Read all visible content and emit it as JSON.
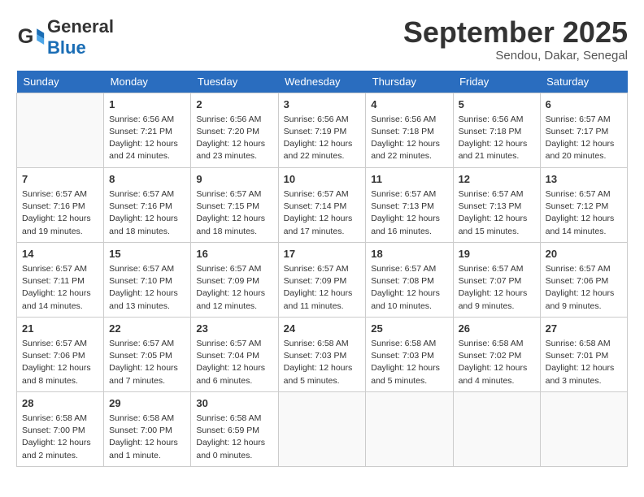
{
  "logo": {
    "general": "General",
    "blue": "Blue"
  },
  "title": "September 2025",
  "location": "Sendou, Dakar, Senegal",
  "weekdays": [
    "Sunday",
    "Monday",
    "Tuesday",
    "Wednesday",
    "Thursday",
    "Friday",
    "Saturday"
  ],
  "weeks": [
    [
      {
        "day": "",
        "info": ""
      },
      {
        "day": "1",
        "info": "Sunrise: 6:56 AM\nSunset: 7:21 PM\nDaylight: 12 hours\nand 24 minutes."
      },
      {
        "day": "2",
        "info": "Sunrise: 6:56 AM\nSunset: 7:20 PM\nDaylight: 12 hours\nand 23 minutes."
      },
      {
        "day": "3",
        "info": "Sunrise: 6:56 AM\nSunset: 7:19 PM\nDaylight: 12 hours\nand 22 minutes."
      },
      {
        "day": "4",
        "info": "Sunrise: 6:56 AM\nSunset: 7:18 PM\nDaylight: 12 hours\nand 22 minutes."
      },
      {
        "day": "5",
        "info": "Sunrise: 6:56 AM\nSunset: 7:18 PM\nDaylight: 12 hours\nand 21 minutes."
      },
      {
        "day": "6",
        "info": "Sunrise: 6:57 AM\nSunset: 7:17 PM\nDaylight: 12 hours\nand 20 minutes."
      }
    ],
    [
      {
        "day": "7",
        "info": "Sunrise: 6:57 AM\nSunset: 7:16 PM\nDaylight: 12 hours\nand 19 minutes."
      },
      {
        "day": "8",
        "info": "Sunrise: 6:57 AM\nSunset: 7:16 PM\nDaylight: 12 hours\nand 18 minutes."
      },
      {
        "day": "9",
        "info": "Sunrise: 6:57 AM\nSunset: 7:15 PM\nDaylight: 12 hours\nand 18 minutes."
      },
      {
        "day": "10",
        "info": "Sunrise: 6:57 AM\nSunset: 7:14 PM\nDaylight: 12 hours\nand 17 minutes."
      },
      {
        "day": "11",
        "info": "Sunrise: 6:57 AM\nSunset: 7:13 PM\nDaylight: 12 hours\nand 16 minutes."
      },
      {
        "day": "12",
        "info": "Sunrise: 6:57 AM\nSunset: 7:13 PM\nDaylight: 12 hours\nand 15 minutes."
      },
      {
        "day": "13",
        "info": "Sunrise: 6:57 AM\nSunset: 7:12 PM\nDaylight: 12 hours\nand 14 minutes."
      }
    ],
    [
      {
        "day": "14",
        "info": "Sunrise: 6:57 AM\nSunset: 7:11 PM\nDaylight: 12 hours\nand 14 minutes."
      },
      {
        "day": "15",
        "info": "Sunrise: 6:57 AM\nSunset: 7:10 PM\nDaylight: 12 hours\nand 13 minutes."
      },
      {
        "day": "16",
        "info": "Sunrise: 6:57 AM\nSunset: 7:09 PM\nDaylight: 12 hours\nand 12 minutes."
      },
      {
        "day": "17",
        "info": "Sunrise: 6:57 AM\nSunset: 7:09 PM\nDaylight: 12 hours\nand 11 minutes."
      },
      {
        "day": "18",
        "info": "Sunrise: 6:57 AM\nSunset: 7:08 PM\nDaylight: 12 hours\nand 10 minutes."
      },
      {
        "day": "19",
        "info": "Sunrise: 6:57 AM\nSunset: 7:07 PM\nDaylight: 12 hours\nand 9 minutes."
      },
      {
        "day": "20",
        "info": "Sunrise: 6:57 AM\nSunset: 7:06 PM\nDaylight: 12 hours\nand 9 minutes."
      }
    ],
    [
      {
        "day": "21",
        "info": "Sunrise: 6:57 AM\nSunset: 7:06 PM\nDaylight: 12 hours\nand 8 minutes."
      },
      {
        "day": "22",
        "info": "Sunrise: 6:57 AM\nSunset: 7:05 PM\nDaylight: 12 hours\nand 7 minutes."
      },
      {
        "day": "23",
        "info": "Sunrise: 6:57 AM\nSunset: 7:04 PM\nDaylight: 12 hours\nand 6 minutes."
      },
      {
        "day": "24",
        "info": "Sunrise: 6:58 AM\nSunset: 7:03 PM\nDaylight: 12 hours\nand 5 minutes."
      },
      {
        "day": "25",
        "info": "Sunrise: 6:58 AM\nSunset: 7:03 PM\nDaylight: 12 hours\nand 5 minutes."
      },
      {
        "day": "26",
        "info": "Sunrise: 6:58 AM\nSunset: 7:02 PM\nDaylight: 12 hours\nand 4 minutes."
      },
      {
        "day": "27",
        "info": "Sunrise: 6:58 AM\nSunset: 7:01 PM\nDaylight: 12 hours\nand 3 minutes."
      }
    ],
    [
      {
        "day": "28",
        "info": "Sunrise: 6:58 AM\nSunset: 7:00 PM\nDaylight: 12 hours\nand 2 minutes."
      },
      {
        "day": "29",
        "info": "Sunrise: 6:58 AM\nSunset: 7:00 PM\nDaylight: 12 hours\nand 1 minute."
      },
      {
        "day": "30",
        "info": "Sunrise: 6:58 AM\nSunset: 6:59 PM\nDaylight: 12 hours\nand 0 minutes."
      },
      {
        "day": "",
        "info": ""
      },
      {
        "day": "",
        "info": ""
      },
      {
        "day": "",
        "info": ""
      },
      {
        "day": "",
        "info": ""
      }
    ]
  ]
}
